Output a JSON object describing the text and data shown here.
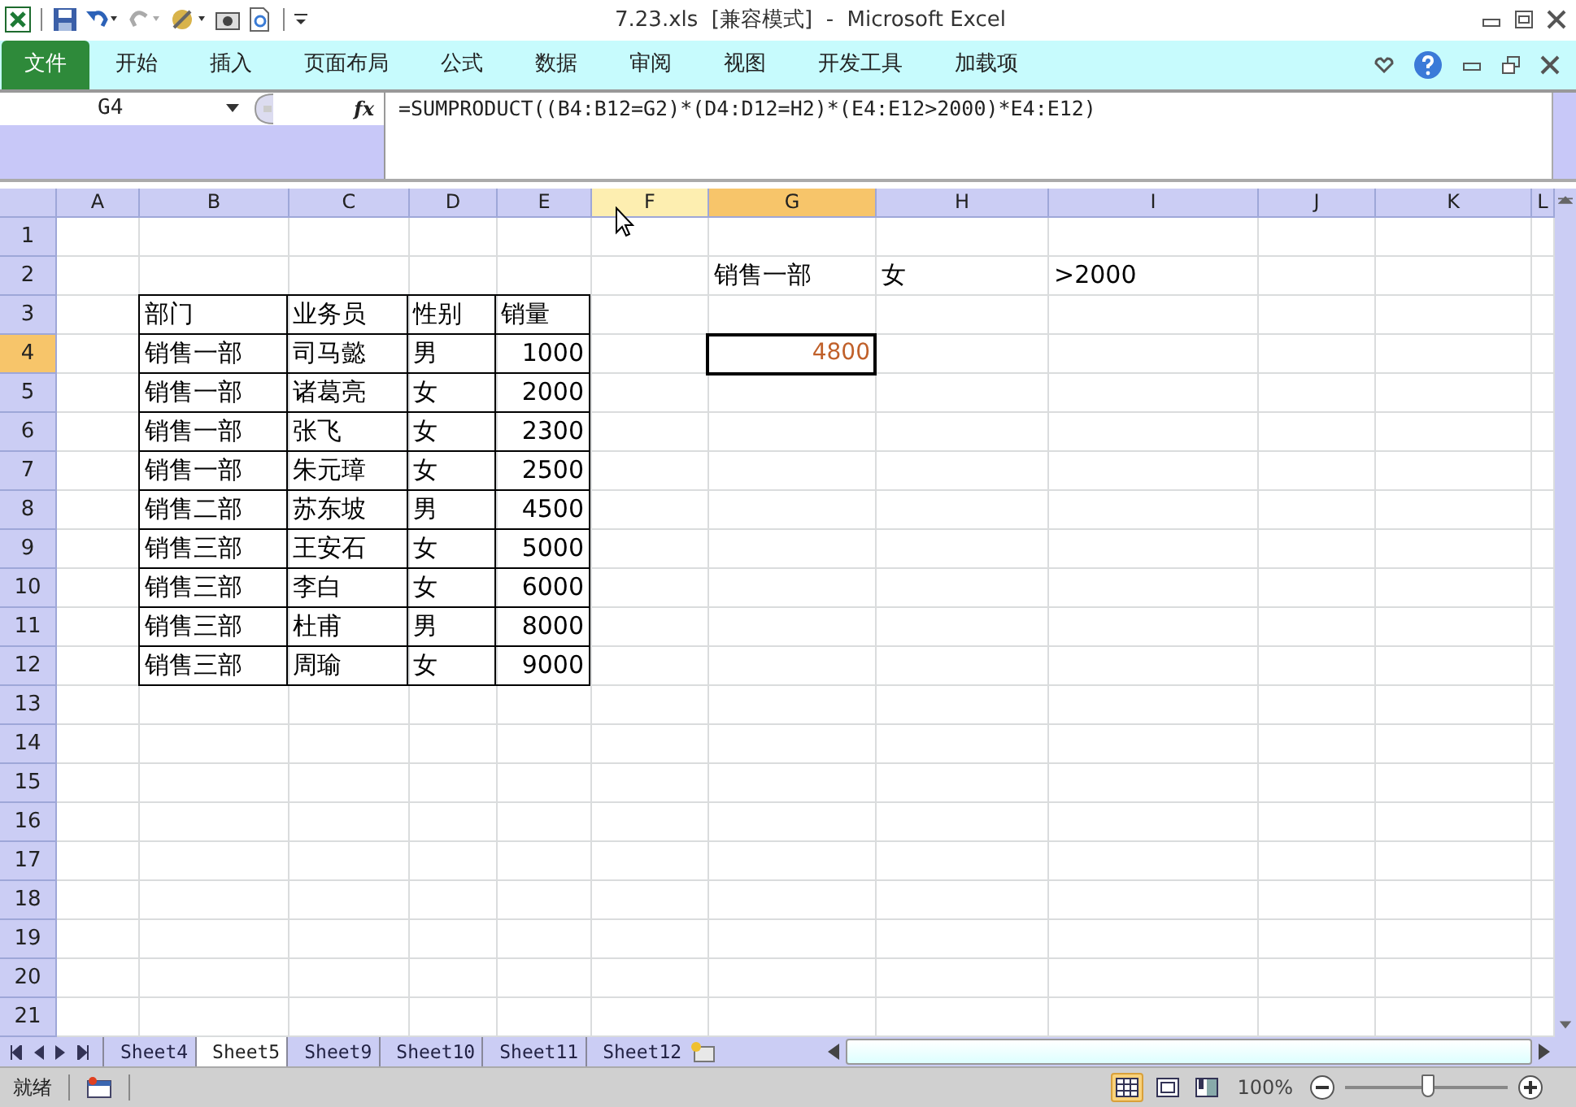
{
  "window": {
    "title": "7.23.xls  [兼容模式]  -  Microsoft Excel"
  },
  "ribbon_tabs": [
    {
      "label": "文件",
      "kind": "file"
    },
    {
      "label": "开始",
      "kind": "tab"
    },
    {
      "label": "插入",
      "kind": "tab"
    },
    {
      "label": "页面布局",
      "kind": "tab"
    },
    {
      "label": "公式",
      "kind": "tab"
    },
    {
      "label": "数据",
      "kind": "tab"
    },
    {
      "label": "审阅",
      "kind": "tab"
    },
    {
      "label": "视图",
      "kind": "tab"
    },
    {
      "label": "开发工具",
      "kind": "tab"
    },
    {
      "label": "加载项",
      "kind": "tab"
    }
  ],
  "name_box": "G4",
  "formula_bar": {
    "fx": "fx",
    "formula": "=SUMPRODUCT((B4:B12=G2)*(D4:D12=H2)*(E4:E12>2000)*E4:E12)"
  },
  "columns": [
    {
      "label": "A",
      "selected": false,
      "hovered": false
    },
    {
      "label": "B",
      "selected": false,
      "hovered": false
    },
    {
      "label": "C",
      "selected": false,
      "hovered": false
    },
    {
      "label": "D",
      "selected": false,
      "hovered": false
    },
    {
      "label": "E",
      "selected": false,
      "hovered": false
    },
    {
      "label": "F",
      "selected": false,
      "hovered": true
    },
    {
      "label": "G",
      "selected": true,
      "hovered": false
    },
    {
      "label": "H",
      "selected": false,
      "hovered": false
    },
    {
      "label": "I",
      "selected": false,
      "hovered": false
    },
    {
      "label": "J",
      "selected": false,
      "hovered": false
    },
    {
      "label": "K",
      "selected": false,
      "hovered": false
    },
    {
      "label": "L",
      "selected": false,
      "hovered": false
    }
  ],
  "rows": [
    {
      "label": "1",
      "selected": false
    },
    {
      "label": "2",
      "selected": false,
      "cells": [
        null,
        null,
        null,
        null,
        null,
        null,
        {
          "text": "销售一部",
          "kind": "text",
          "bordered": false
        },
        {
          "text": "女",
          "kind": "text",
          "bordered": false
        },
        {
          "text": ">2000",
          "kind": "text",
          "bordered": false
        }
      ]
    },
    {
      "label": "3",
      "selected": false,
      "cells": [
        null,
        {
          "text": "部门",
          "kind": "text",
          "bordered": true
        },
        {
          "text": "业务员",
          "kind": "text",
          "bordered": true
        },
        {
          "text": "性别",
          "kind": "text",
          "bordered": true
        },
        {
          "text": "销量",
          "kind": "text",
          "bordered": true
        }
      ]
    },
    {
      "label": "4",
      "selected": true,
      "cells": [
        null,
        {
          "text": "销售一部",
          "kind": "text",
          "bordered": true
        },
        {
          "text": "司马懿",
          "kind": "text",
          "bordered": true
        },
        {
          "text": "男",
          "kind": "text",
          "bordered": true
        },
        {
          "text": "1000",
          "kind": "number",
          "bordered": true
        },
        null,
        {
          "text": "4800",
          "kind": "number",
          "bordered": false,
          "selected": true
        }
      ]
    },
    {
      "label": "5",
      "selected": false,
      "cells": [
        null,
        {
          "text": "销售一部",
          "kind": "text",
          "bordered": true
        },
        {
          "text": "诸葛亮",
          "kind": "text",
          "bordered": true
        },
        {
          "text": "女",
          "kind": "text",
          "bordered": true
        },
        {
          "text": "2000",
          "kind": "number",
          "bordered": true
        }
      ]
    },
    {
      "label": "6",
      "selected": false,
      "cells": [
        null,
        {
          "text": "销售一部",
          "kind": "text",
          "bordered": true
        },
        {
          "text": "张飞",
          "kind": "text",
          "bordered": true
        },
        {
          "text": "女",
          "kind": "text",
          "bordered": true
        },
        {
          "text": "2300",
          "kind": "number",
          "bordered": true
        }
      ]
    },
    {
      "label": "7",
      "selected": false,
      "cells": [
        null,
        {
          "text": "销售一部",
          "kind": "text",
          "bordered": true
        },
        {
          "text": "朱元璋",
          "kind": "text",
          "bordered": true
        },
        {
          "text": "女",
          "kind": "text",
          "bordered": true
        },
        {
          "text": "2500",
          "kind": "number",
          "bordered": true
        }
      ]
    },
    {
      "label": "8",
      "selected": false,
      "cells": [
        null,
        {
          "text": "销售二部",
          "kind": "text",
          "bordered": true
        },
        {
          "text": "苏东坡",
          "kind": "text",
          "bordered": true
        },
        {
          "text": "男",
          "kind": "text",
          "bordered": true
        },
        {
          "text": "4500",
          "kind": "number",
          "bordered": true
        }
      ]
    },
    {
      "label": "9",
      "selected": false,
      "cells": [
        null,
        {
          "text": "销售三部",
          "kind": "text",
          "bordered": true
        },
        {
          "text": "王安石",
          "kind": "text",
          "bordered": true
        },
        {
          "text": "女",
          "kind": "text",
          "bordered": true
        },
        {
          "text": "5000",
          "kind": "number",
          "bordered": true
        }
      ]
    },
    {
      "label": "10",
      "selected": false,
      "cells": [
        null,
        {
          "text": "销售三部",
          "kind": "text",
          "bordered": true
        },
        {
          "text": "李白",
          "kind": "text",
          "bordered": true
        },
        {
          "text": "女",
          "kind": "text",
          "bordered": true
        },
        {
          "text": "6000",
          "kind": "number",
          "bordered": true
        }
      ]
    },
    {
      "label": "11",
      "selected": false,
      "cells": [
        null,
        {
          "text": "销售三部",
          "kind": "text",
          "bordered": true
        },
        {
          "text": "杜甫",
          "kind": "text",
          "bordered": true
        },
        {
          "text": "男",
          "kind": "text",
          "bordered": true
        },
        {
          "text": "8000",
          "kind": "number",
          "bordered": true
        }
      ]
    },
    {
      "label": "12",
      "selected": false,
      "cells": [
        null,
        {
          "text": "销售三部",
          "kind": "text",
          "bordered": true
        },
        {
          "text": "周瑜",
          "kind": "text",
          "bordered": true
        },
        {
          "text": "女",
          "kind": "text",
          "bordered": true
        },
        {
          "text": "9000",
          "kind": "number",
          "bordered": true
        }
      ]
    },
    {
      "label": "13",
      "selected": false
    },
    {
      "label": "14",
      "selected": false
    },
    {
      "label": "15",
      "selected": false
    },
    {
      "label": "16",
      "selected": false
    },
    {
      "label": "17",
      "selected": false
    },
    {
      "label": "18",
      "selected": false
    },
    {
      "label": "19",
      "selected": false
    },
    {
      "label": "20",
      "selected": false
    },
    {
      "label": "21",
      "selected": false
    }
  ],
  "sheet_tabs": [
    {
      "label": "Sheet4",
      "selected": false
    },
    {
      "label": "Sheet5",
      "selected": true
    },
    {
      "label": "Sheet9",
      "selected": false
    },
    {
      "label": "Sheet10",
      "selected": false
    },
    {
      "label": "Sheet11",
      "selected": false
    },
    {
      "label": "Sheet12",
      "selected": false
    }
  ],
  "status_bar": {
    "status": "就绪",
    "views": [
      {
        "kind": "normal",
        "selected": true
      },
      {
        "kind": "layout",
        "selected": false
      },
      {
        "kind": "pagebreak",
        "selected": false
      }
    ],
    "zoom": "100%",
    "zoom_slider": {
      "level": 0.51
    }
  }
}
